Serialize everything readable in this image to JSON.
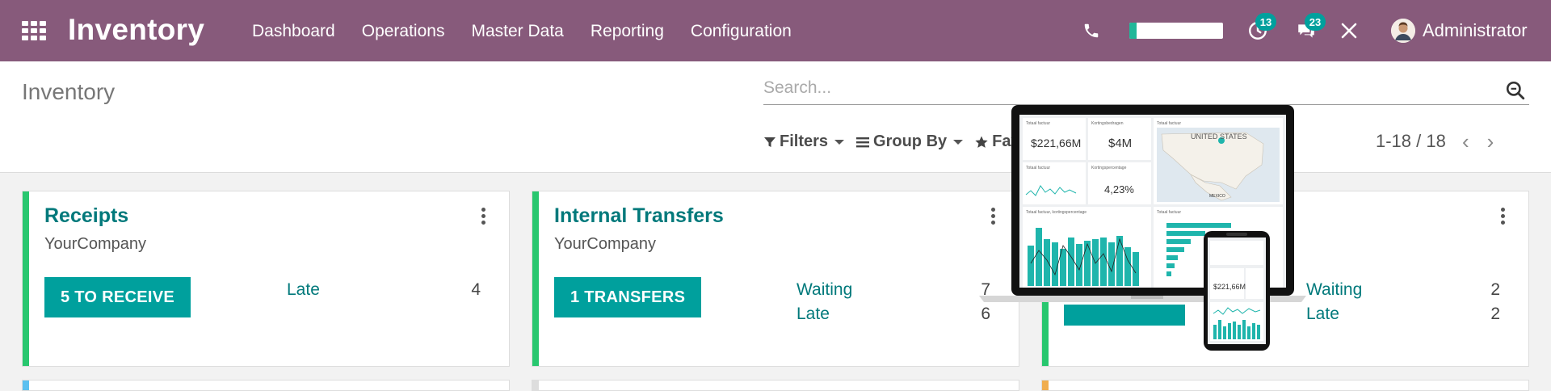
{
  "nav": {
    "brand": "Inventory",
    "menu": [
      "Dashboard",
      "Operations",
      "Master Data",
      "Reporting",
      "Configuration"
    ],
    "activity_count": "13",
    "message_count": "23",
    "progress_percent": 8,
    "user_name": "Administrator"
  },
  "control": {
    "page_title": "Inventory",
    "search_placeholder": "Search...",
    "filters_label": "Filters",
    "group_by_label": "Group By",
    "favorites_label": "Favo",
    "pager": "1-18 / 18"
  },
  "cards": [
    {
      "title": "Receipts",
      "company": "YourCompany",
      "action": "5 TO RECEIVE",
      "stats": [
        {
          "label": "Late",
          "value": "4"
        }
      ],
      "stripe_color": "#28c76f"
    },
    {
      "title": "Internal Transfers",
      "company": "YourCompany",
      "action": "1 TRANSFERS",
      "stats": [
        {
          "label": "Waiting",
          "value": "7"
        },
        {
          "label": "Late",
          "value": "6"
        }
      ],
      "stripe_color": "#28c76f"
    },
    {
      "title": "",
      "company": "",
      "action": "",
      "stats": [
        {
          "label": "Waiting",
          "value": "2"
        },
        {
          "label": "Late",
          "value": "2"
        }
      ],
      "stripe_color": "#28c76f"
    }
  ],
  "promo": {
    "tiles": [
      {
        "label": "Totaal factuur",
        "value": "$221,66M"
      },
      {
        "label": "Kortingsbedragen",
        "value": "$4M"
      },
      {
        "label": "Totaal factuur",
        "value": ""
      },
      {
        "label": "Kortingspercentage",
        "value": "4,23%"
      }
    ],
    "map_country": "UNITED STATES",
    "map_label2": "MEXICO",
    "bottom_title": "Totaal factuur, kortingspercentage",
    "bottom_title2": "Totaal factuur",
    "phone_value": "$221,66M"
  },
  "colors": {
    "brand_purple": "#875a7b",
    "teal": "#00a09d",
    "title_teal": "#01797b",
    "stripe_green": "#28c76f",
    "stripe_blue": "#5bc0f0",
    "stripe_orange": "#f0ad4e"
  }
}
